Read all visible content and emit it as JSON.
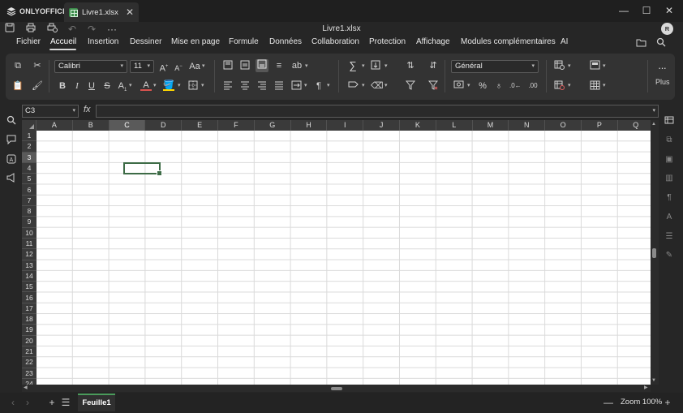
{
  "app": {
    "brand": "ONLYOFFICE",
    "tab_title": "Livre1.xlsx",
    "doc_title": "Livre1.xlsx",
    "user_initial": "R"
  },
  "menu": {
    "tabs": [
      "Fichier",
      "Accueil",
      "Insertion",
      "Dessiner",
      "Mise en page",
      "Formule",
      "Données",
      "Collaboration",
      "Protection",
      "Affichage",
      "Modules complémentaires",
      "AI"
    ],
    "active": "Accueil"
  },
  "toolbar": {
    "font_name": "Calibri",
    "font_size": "11",
    "number_format": "Général",
    "more_label": "Plus",
    "font_color": "#d9534f",
    "fill_color": "#ffd700"
  },
  "formula_bar": {
    "name_box": "C3",
    "fx": "fx",
    "formula": ""
  },
  "grid": {
    "columns": [
      "A",
      "B",
      "C",
      "D",
      "E",
      "F",
      "G",
      "H",
      "I",
      "J",
      "K",
      "L",
      "M",
      "N",
      "O",
      "P",
      "Q"
    ],
    "rows": [
      "1",
      "2",
      "3",
      "4",
      "5",
      "6",
      "7",
      "8",
      "9",
      "10",
      "11",
      "12",
      "13",
      "14",
      "15",
      "16",
      "17",
      "18",
      "19",
      "20",
      "21",
      "22",
      "23",
      "24"
    ],
    "selected_column": "C",
    "selected_row": "3"
  },
  "status": {
    "sheet_tab": "Feuille1",
    "zoom": "Zoom 100%"
  }
}
